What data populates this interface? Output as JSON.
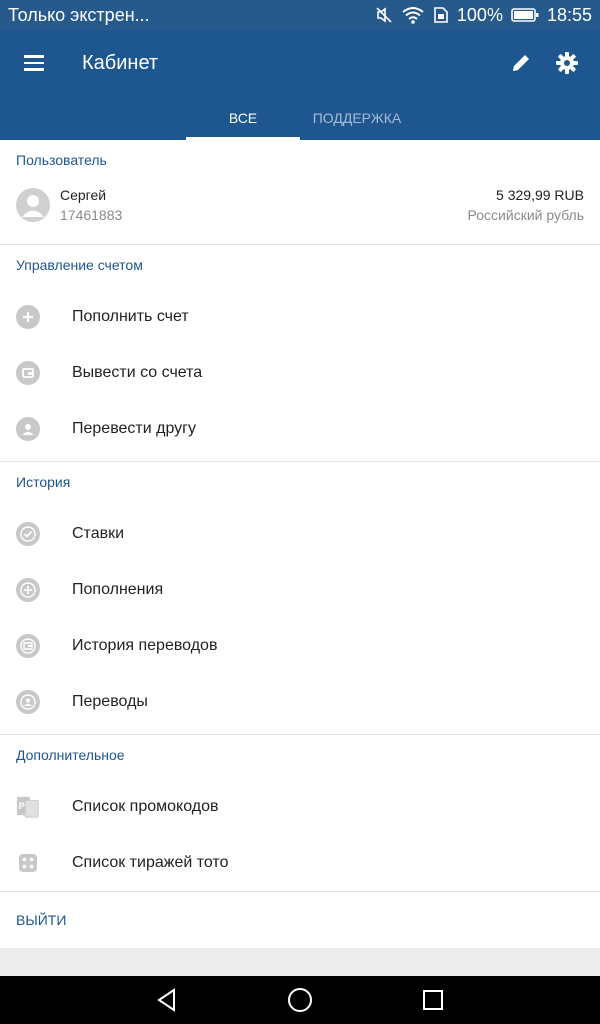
{
  "status_bar": {
    "notice": "Только экстрен...",
    "battery": "100%",
    "time": "18:55"
  },
  "app_bar": {
    "title": "Кабинет",
    "tabs": [
      {
        "label": "ВСЕ",
        "active": true
      },
      {
        "label": "ПОДДЕРЖКА",
        "active": false
      }
    ]
  },
  "user_section": {
    "header": "Пользователь",
    "name": "Сергей",
    "id": "17461883",
    "balance": "5 329,99 RUB",
    "currency": "Российский рубль"
  },
  "account_section": {
    "header": "Управление счетом",
    "items": [
      {
        "label": "Пополнить счет",
        "icon": "plus-circle-icon"
      },
      {
        "label": "Вывести со счета",
        "icon": "wallet-icon"
      },
      {
        "label": "Перевести другу",
        "icon": "person-icon"
      }
    ]
  },
  "history_section": {
    "header": "История",
    "items": [
      {
        "label": "Ставки",
        "icon": "check-history-icon"
      },
      {
        "label": "Пополнения",
        "icon": "plus-history-icon"
      },
      {
        "label": "История переводов",
        "icon": "wallet-history-icon"
      },
      {
        "label": "Переводы",
        "icon": "person-history-icon"
      }
    ]
  },
  "extra_section": {
    "header": "Дополнительное",
    "items": [
      {
        "label": "Список промокодов",
        "icon": "promo-icon"
      },
      {
        "label": "Список тиражей тото",
        "icon": "dice-icon"
      }
    ]
  },
  "logout_label": "ВЫЙТИ",
  "colors": {
    "primary": "#1e568f",
    "status_bar": "#275a8c",
    "icon_gray": "#c8c8c8"
  }
}
